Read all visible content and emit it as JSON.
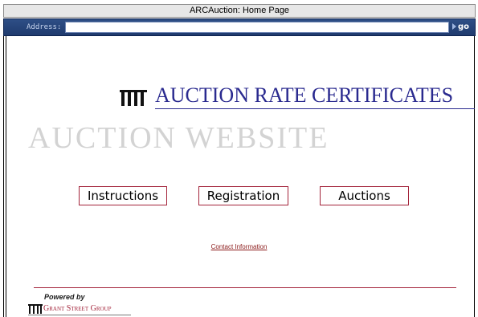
{
  "window": {
    "title": "ARCAuction: Home Page"
  },
  "addressbar": {
    "label": "Address:",
    "value": "",
    "go_label": "go"
  },
  "hero": {
    "title": "AUCTION RATE CERTIFICATES",
    "subtitle": "AUCTION WEBSITE",
    "logo_icon": "columns-building-icon"
  },
  "nav": {
    "items": [
      {
        "label": "Instructions"
      },
      {
        "label": "Registration"
      },
      {
        "label": "Auctions"
      }
    ]
  },
  "contact": {
    "label": "Contact Information"
  },
  "footer": {
    "powered_by": "Powered by",
    "company": "Grant Street Group"
  },
  "colors": {
    "accent": "#a3233a",
    "title_blue": "#2a2a8f",
    "address_bar": "#1f3b6e"
  }
}
